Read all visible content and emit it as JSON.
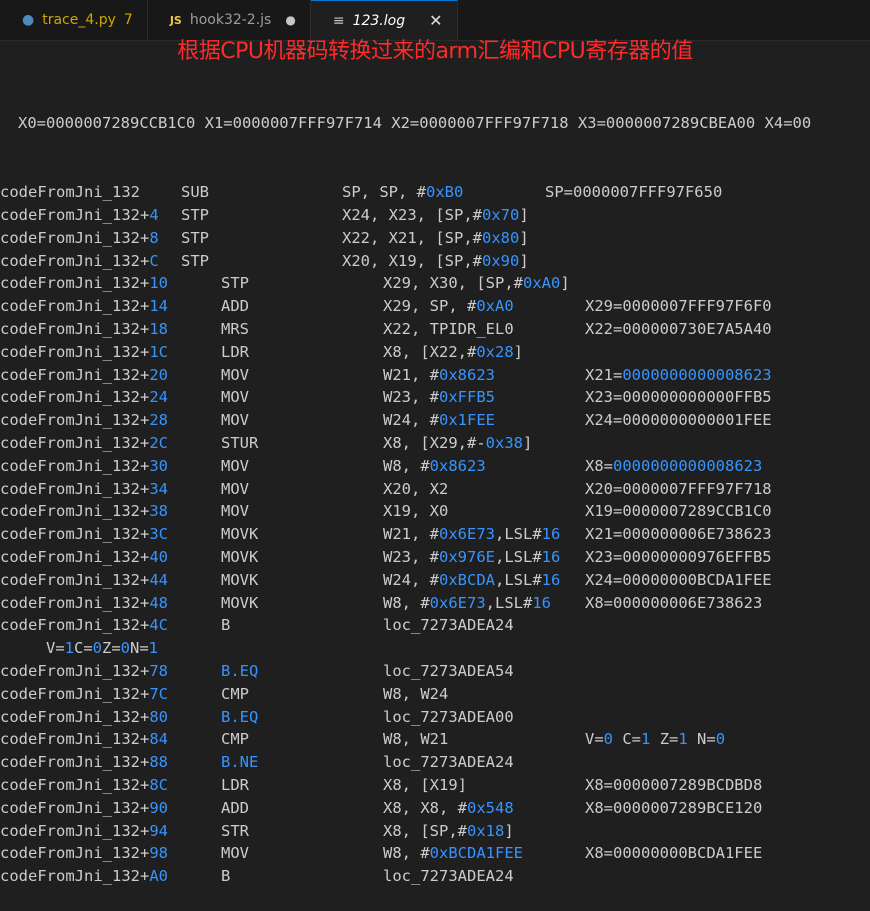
{
  "tabs": [
    {
      "label": "trace_4.py",
      "count": "7",
      "icon": "python-icon"
    },
    {
      "label": "hook32-2.js",
      "icon": "javascript-icon"
    },
    {
      "label": "123.log",
      "icon": "log-file-icon",
      "active": true
    }
  ],
  "annotation": "根据CPU机器码转换过来的arm汇编和CPU寄存器的值",
  "registers_header": "X0=0000007289CCB1C0 X1=0000007FFF97F714 X2=0000007FFF97F718 X3=0000007289CBEA00 X4=00",
  "flags_line": {
    "V": "1",
    "C": "0",
    "Z": "0",
    "N": "1"
  },
  "colors": {
    "accent_blue": "#3794ff",
    "annotation_red": "#ff2a2a",
    "background": "#1f1f1f"
  },
  "lines": [
    {
      "fn": "codeFromJni_132",
      "off": "",
      "op": "SUB",
      "args": "SP, SP, #",
      "imm": "0xB0",
      "rest": "",
      "result": "SP=0000007FFF97F650",
      "group": 1
    },
    {
      "fn": "codeFromJni_132+",
      "off": "4",
      "op": "STP",
      "args": "X24, X23, [SP,#",
      "imm": "0x70",
      "rest": "]",
      "result": "",
      "group": 1
    },
    {
      "fn": "codeFromJni_132+",
      "off": "8",
      "op": "STP",
      "args": "X22, X21, [SP,#",
      "imm": "0x80",
      "rest": "]",
      "result": "",
      "group": 1
    },
    {
      "fn": "codeFromJni_132+",
      "off": "C",
      "op": "STP",
      "args": "X20, X19, [SP,#",
      "imm": "0x90",
      "rest": "]",
      "result": "",
      "group": 1
    },
    {
      "fn": "codeFromJni_132+",
      "off": "10",
      "op": "STP",
      "args": "X29, X30, [SP,#",
      "imm": "0xA0",
      "rest": "]",
      "result": "",
      "group": 2
    },
    {
      "fn": "codeFromJni_132+",
      "off": "14",
      "op": "ADD",
      "args": "X29, SP, #",
      "imm": "0xA0",
      "rest": "",
      "result": "X29=0000007FFF97F6F0",
      "group": 2
    },
    {
      "fn": "codeFromJni_132+",
      "off": "18",
      "op": "MRS",
      "args": "X22, TPIDR_EL0",
      "imm": "",
      "rest": "",
      "result": "X22=000000730E7A5A40",
      "group": 2
    },
    {
      "fn": "codeFromJni_132+",
      "off": "1C",
      "op": "LDR",
      "args": "X8, [X22,#",
      "imm": "0x28",
      "rest": "]",
      "result": "",
      "group": 2
    },
    {
      "fn": "codeFromJni_132+",
      "off": "20",
      "op": "MOV",
      "args": "W21, #",
      "imm": "0x8623",
      "rest": "",
      "result": "X21=",
      "result_blue": "0000000000008623",
      "group": 2
    },
    {
      "fn": "codeFromJni_132+",
      "off": "24",
      "op": "MOV",
      "args": "W23, #",
      "imm": "0xFFB5",
      "rest": "",
      "result": "X23=000000000000FFB5",
      "group": 2
    },
    {
      "fn": "codeFromJni_132+",
      "off": "28",
      "op": "MOV",
      "args": "W24, #",
      "imm": "0x1FEE",
      "rest": "",
      "result": "X24=0000000000001FEE",
      "group": 2
    },
    {
      "fn": "codeFromJni_132+",
      "off": "2C",
      "op": "STUR",
      "args": "X8, [X29,#-",
      "imm": "0x38",
      "rest": "]",
      "result": "",
      "group": 2
    },
    {
      "fn": "codeFromJni_132+",
      "off": "30",
      "op": "MOV",
      "args": "W8, #",
      "imm": "0x8623",
      "rest": "",
      "result": "X8=",
      "result_blue": "0000000000008623",
      "group": 2
    },
    {
      "fn": "codeFromJni_132+",
      "off": "34",
      "op": "MOV",
      "args": "X20, X2",
      "imm": "",
      "rest": "",
      "result": "X20=0000007FFF97F718",
      "group": 2
    },
    {
      "fn": "codeFromJni_132+",
      "off": "38",
      "op": "MOV",
      "args": "X19, X0",
      "imm": "",
      "rest": "",
      "result": "X19=0000007289CCB1C0",
      "group": 2
    },
    {
      "fn": "codeFromJni_132+",
      "off": "3C",
      "op": "MOVK",
      "args": "W21, #",
      "imm": "0x6E73",
      "rest": ",LSL#",
      "imm2": "16",
      "result": "X21=000000006E738623",
      "group": 2
    },
    {
      "fn": "codeFromJni_132+",
      "off": "40",
      "op": "MOVK",
      "args": "W23, #",
      "imm": "0x976E",
      "rest": ",LSL#",
      "imm2": "16",
      "result": "X23=00000000976EFFB5",
      "group": 2
    },
    {
      "fn": "codeFromJni_132+",
      "off": "44",
      "op": "MOVK",
      "args": "W24, #",
      "imm": "0xBCDA",
      "rest": ",LSL#",
      "imm2": "16",
      "result": "X24=00000000BCDA1FEE",
      "group": 2
    },
    {
      "fn": "codeFromJni_132+",
      "off": "48",
      "op": "MOVK",
      "args": "W8, #",
      "imm": "0x6E73",
      "rest": ",LSL#",
      "imm2": "16",
      "result": "X8=000000006E738623",
      "group": 2
    },
    {
      "fn": "codeFromJni_132+",
      "off": "4C",
      "op": "B",
      "args": "loc_7273ADEA24",
      "imm": "",
      "rest": "",
      "result": "",
      "group": 2
    },
    {
      "flags": true
    },
    {
      "fn": "codeFromJni_132+",
      "off": "78",
      "op": "B.EQ",
      "op_blue": true,
      "args": "loc_7273ADEA54",
      "imm": "",
      "rest": "",
      "result": "",
      "group": 2
    },
    {
      "fn": "codeFromJni_132+",
      "off": "7C",
      "op": "CMP",
      "args": "W8, W24",
      "imm": "",
      "rest": "",
      "result": "",
      "group": 2
    },
    {
      "fn": "codeFromJni_132+",
      "off": "80",
      "op": "B.EQ",
      "op_blue": true,
      "args": "loc_7273ADEA00",
      "imm": "",
      "rest": "",
      "result": "",
      "group": 2
    },
    {
      "fn": "codeFromJni_132+",
      "off": "84",
      "op": "CMP",
      "args": "W8, W21",
      "imm": "",
      "rest": "",
      "result": "",
      "flags_result": {
        "V": "0",
        "C": "1",
        "Z": "1",
        "N": "0"
      },
      "group": 2
    },
    {
      "fn": "codeFromJni_132+",
      "off": "88",
      "op": "B.NE",
      "op_blue": true,
      "args": "loc_7273ADEA24",
      "imm": "",
      "rest": "",
      "result": "",
      "group": 2
    },
    {
      "fn": "codeFromJni_132+",
      "off": "8C",
      "op": "LDR",
      "args": "X8, [X19]",
      "imm": "",
      "rest": "",
      "result": "X8=0000007289BCDBD8",
      "group": 2
    },
    {
      "fn": "codeFromJni_132+",
      "off": "90",
      "op": "ADD",
      "args": "X8, X8, #",
      "imm": "0x548",
      "rest": "",
      "result": "X8=0000007289BCE120",
      "group": 2
    },
    {
      "fn": "codeFromJni_132+",
      "off": "94",
      "op": "STR",
      "args": "X8, [SP,#",
      "imm": "0x18",
      "rest": "]",
      "result": "",
      "group": 2
    },
    {
      "fn": "codeFromJni_132+",
      "off": "98",
      "op": "MOV",
      "args": "W8, #",
      "imm": "0xBCDA1FEE",
      "rest": "",
      "result": "X8=00000000BCDA1FEE",
      "group": 2
    },
    {
      "fn": "codeFromJni_132+",
      "off": "A0",
      "op": "B",
      "args": "loc_7273ADEA24",
      "imm": "",
      "rest": "",
      "result": "",
      "group": 2
    }
  ]
}
